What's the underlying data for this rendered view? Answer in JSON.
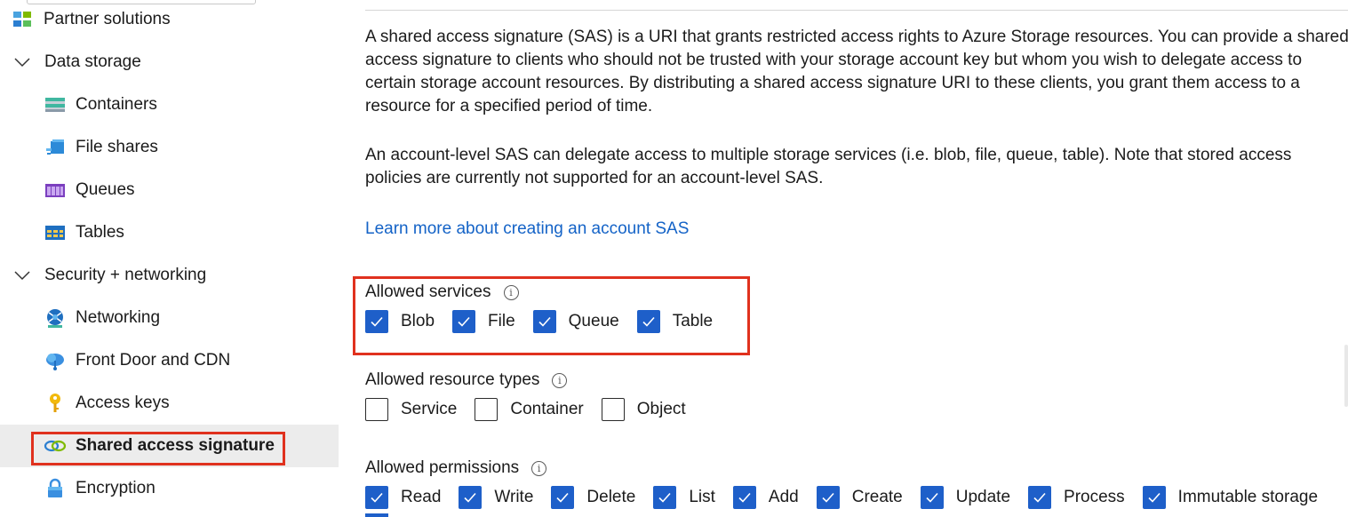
{
  "sidebar": {
    "items": [
      {
        "label": "Partner solutions"
      },
      {
        "label": "Data storage"
      },
      {
        "label": "Containers"
      },
      {
        "label": "File shares"
      },
      {
        "label": "Queues"
      },
      {
        "label": "Tables"
      },
      {
        "label": "Security + networking"
      },
      {
        "label": "Networking"
      },
      {
        "label": "Front Door and CDN"
      },
      {
        "label": "Access keys"
      },
      {
        "label": "Shared access signature"
      },
      {
        "label": "Encryption"
      }
    ],
    "selected": "Shared access signature",
    "icons": {
      "partner": "partner-solutions-icon",
      "containers": "containers-icon",
      "fileshares": "file-shares-icon",
      "queues": "queues-icon",
      "tables": "tables-icon",
      "networking": "networking-icon",
      "frontdoor": "front-door-icon",
      "accesskeys": "key-icon",
      "sas": "link-icon",
      "encryption": "lock-icon"
    }
  },
  "main": {
    "paragraph1": "A shared access signature (SAS) is a URI that grants restricted access rights to Azure Storage resources. You can provide a shared access signature to clients who should not be trusted with your storage account key but whom you wish to delegate access to certain storage account resources. By distributing a shared access signature URI to these clients, you grant them access to a resource for a specified period of time.",
    "paragraph2": "An account-level SAS can delegate access to multiple storage services (i.e. blob, file, queue, table). Note that stored access policies are currently not supported for an account-level SAS.",
    "learn_more": "Learn more about creating an account SAS",
    "allowed_services": {
      "label": "Allowed services",
      "options": [
        {
          "label": "Blob",
          "checked": true
        },
        {
          "label": "File",
          "checked": true
        },
        {
          "label": "Queue",
          "checked": true
        },
        {
          "label": "Table",
          "checked": true
        }
      ]
    },
    "allowed_resource_types": {
      "label": "Allowed resource types",
      "options": [
        {
          "label": "Service",
          "checked": false
        },
        {
          "label": "Container",
          "checked": false
        },
        {
          "label": "Object",
          "checked": false
        }
      ]
    },
    "allowed_permissions": {
      "label": "Allowed permissions",
      "options": [
        {
          "label": "Read",
          "checked": true
        },
        {
          "label": "Write",
          "checked": true
        },
        {
          "label": "Delete",
          "checked": true
        },
        {
          "label": "List",
          "checked": true
        },
        {
          "label": "Add",
          "checked": true
        },
        {
          "label": "Create",
          "checked": true
        },
        {
          "label": "Update",
          "checked": true
        },
        {
          "label": "Process",
          "checked": true
        },
        {
          "label": "Immutable storage",
          "checked": true
        }
      ]
    }
  },
  "colors": {
    "accent": "#1e5fc9",
    "link": "#1463c7",
    "highlight": "#e0311e",
    "selected_bg": "#ececec"
  }
}
